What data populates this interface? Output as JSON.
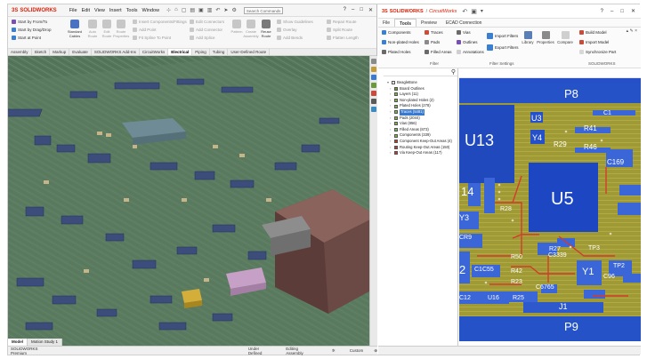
{
  "left_window": {
    "brand": "SOLIDWORKS",
    "menu": [
      "File",
      "Edit",
      "View",
      "Insert",
      "Tools",
      "Window"
    ],
    "search_placeholder": "Search Commands",
    "commands": {
      "col1": [
        "Start by From/To",
        "Start by Drag/Drop",
        "Start at Point"
      ],
      "standard_cables": "Standard Cables",
      "auto_route": "Auto Route",
      "edit_route": "Edit Route",
      "route_properties": "Route Properties",
      "col2": [
        "Insert Components/Fittings",
        "Add Point",
        "Fit Spline To Point"
      ],
      "col3": [
        "Edit Connectors",
        "Add Connector",
        "Add Splice"
      ],
      "pattern": "Pattern",
      "create_assembly": "Create Assembly",
      "reuse_route": "Reuse Route",
      "col4": [
        "Show Guidelines",
        "Overlay",
        "Add Bends"
      ],
      "col5": [
        "Repair Route",
        "Split Route",
        "Flatten Length"
      ]
    },
    "cmd_tabs": [
      "Assembly",
      "Sketch",
      "Markup",
      "Evaluate",
      "SOLIDWORKS Add-Ins",
      "CircuitWorks",
      "Electrical",
      "Piping",
      "Tubing",
      "User-Defined Route"
    ],
    "active_tab": "Electrical",
    "bottom_tabs": [
      "Model",
      "Motion Study 1"
    ],
    "status": {
      "app": "SOLIDWORKS Premium",
      "state": "Under Defined",
      "mode": "Editing Assembly",
      "units": "Custom"
    }
  },
  "right_window": {
    "brand": "SOLIDWORKS",
    "product": "CircuitWorks",
    "tabs": [
      "File",
      "Tools",
      "Preview",
      "ECAD Connection"
    ],
    "active_tab": "Tools",
    "ribbon": {
      "filter_items": [
        "Components",
        "Traces",
        "Vias",
        "Non-plated Holes",
        "Pads",
        "Outlines",
        "Plated Holes",
        "Filled Areas",
        "Annotations"
      ],
      "filter_label": "Filter",
      "filter_settings": [
        "Import Filters",
        "Export Filters"
      ],
      "filter_settings_label": "Filter Settings",
      "library": "Library",
      "properties": "Properties",
      "compare": "Compare",
      "solidworks_items": [
        "Build Model",
        "Import Model",
        "Synchronize Part"
      ],
      "solidworks_label": "SOLIDWORKS"
    },
    "tree": [
      {
        "label": "BeagleBone",
        "color": "#ffffff",
        "top": true
      },
      {
        "label": "Board Outlines",
        "color": "#6a9d3a"
      },
      {
        "label": "Layers (11)",
        "color": "#7fb347"
      },
      {
        "label": "Non-plated Holes (2)",
        "color": "#7fb347"
      },
      {
        "label": "Plated Holes (278)",
        "color": "#7fb347"
      },
      {
        "label": "Traces (5481)",
        "color": "#7fb347",
        "selected": true
      },
      {
        "label": "Pads (2044)",
        "color": "#7fb347"
      },
      {
        "label": "Vias (856)",
        "color": "#7fb347"
      },
      {
        "label": "Filled Areas (873)",
        "color": "#7fb347"
      },
      {
        "label": "Components (339)",
        "color": "#7fb347"
      },
      {
        "label": "Component Keep-Out Areas (4)",
        "color": "#c0392b"
      },
      {
        "label": "Routing Keep-Out Areas (150)",
        "color": "#c0392b"
      },
      {
        "label": "Via Keep-Out Areas (117)",
        "color": "#c0392b"
      }
    ],
    "designators": {
      "p8": "P8",
      "u13": "U13",
      "u3": "U3",
      "y4": "Y4",
      "r29": "R29",
      "u5": "U5",
      "c169": "C169",
      "r14": "14",
      "r28": "R28",
      "y3": "Y3",
      "p9": "P9",
      "j1": "J1",
      "y1": "Y1",
      "tp3": "TP3",
      "tp2": "TP2",
      "c96": "C96",
      "r50": "R50",
      "r27": "R27",
      "c1c55": "C1C55",
      "r42": "R42",
      "r23": "R23",
      "r25": "R25",
      "u16": "U16",
      "c12": "C12",
      "r2": "2",
      "c6765": "C6765",
      "c3339": "C3339",
      "c1": "C1",
      "r46": "R46",
      "r41": "R41",
      "cr9": "CR9"
    }
  },
  "colors": {
    "accent": "#d81e05",
    "pcb_green": "#5f7f63",
    "pcb_2d_yellow": "#a5a13a",
    "pcb_2d_blue": "#1d4ec9",
    "pcb_2d_red": "#d33b2c",
    "selection_blue": "#3778d0"
  }
}
